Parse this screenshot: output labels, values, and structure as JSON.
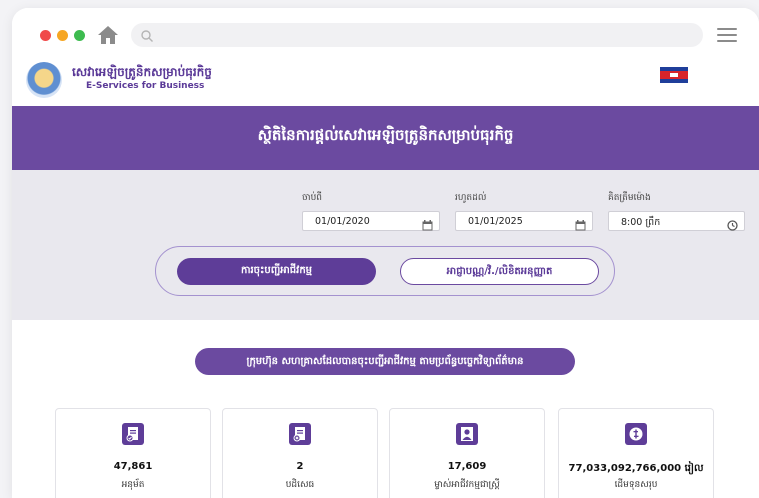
{
  "brand": {
    "khmer_name": "សេវាអេឡិចត្រូនិកសម្រាប់ធុរកិច្ច",
    "english_name": "E-Services for Business"
  },
  "banner": {
    "title": "ស្ថិតិនៃការផ្តល់សេវាអេឡិចត្រូនិកសម្រាប់ធុរកិច្ច"
  },
  "filters": {
    "start_label": "ចាប់ពី",
    "start_value": "01/01/2020",
    "end_label": "រហូតដល់",
    "end_value": "01/01/2025",
    "time_label": "គិតត្រឹមម៉ោង",
    "time_value": "8:00 ព្រឹក"
  },
  "toggle": {
    "active_label": "ការចុះបញ្ជីអាជីវកម្ម",
    "inactive_label": "អាជ្ញាបណ្ណ/វិ./លិខិតអនុញ្ញាត"
  },
  "section": {
    "heading": "ក្រុមហ៊ុន សហគ្រាសដែលបានចុះបញ្ជីអាជីវកម្ម តាមប្រព័ន្ធបច្ចេកវិទ្យាព័ត៌មាន"
  },
  "stats": [
    {
      "value": "47,861",
      "label": "អនុម័ត",
      "icon": "approved-document-icon"
    },
    {
      "value": "2",
      "label": "បដិសេធ",
      "icon": "rejected-document-icon"
    },
    {
      "value": "17,609",
      "label": "ម្ចាស់អាជីវកម្មជាស្ត្រី",
      "icon": "woman-owner-icon"
    },
    {
      "value": "77,033,092,766,000 រៀល",
      "label": "ដើមទុនសរុប",
      "icon": "capital-icon"
    }
  ],
  "colors": {
    "brand_purple": "#6b4aa0",
    "button_purple": "#5e3d98",
    "filter_bg": "#e9e8ee"
  }
}
